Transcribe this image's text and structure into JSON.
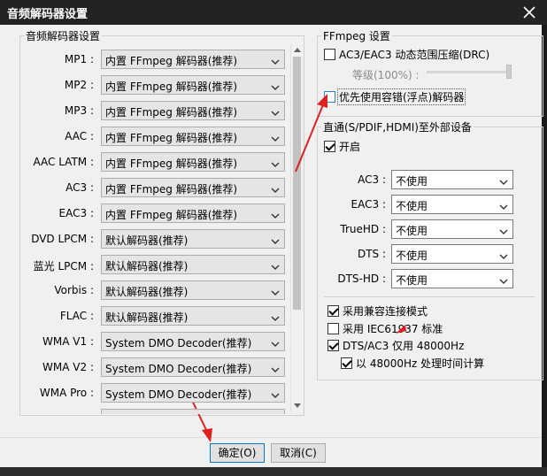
{
  "window": {
    "title": "音频解码器设置"
  },
  "left_group": {
    "title": "音频解码器设置",
    "rows": [
      {
        "label": "MP1 :",
        "value": "内置 FFmpeg 解码器(推荐)"
      },
      {
        "label": "MP2 :",
        "value": "内置 FFmpeg 解码器(推荐)"
      },
      {
        "label": "MP3 :",
        "value": "内置 FFmpeg 解码器(推荐)"
      },
      {
        "label": "AAC :",
        "value": "内置 FFmpeg 解码器(推荐)"
      },
      {
        "label": "AAC LATM :",
        "value": "内置 FFmpeg 解码器(推荐)"
      },
      {
        "label": "AC3 :",
        "value": "内置 FFmpeg 解码器(推荐)"
      },
      {
        "label": "EAC3 :",
        "value": "内置 FFmpeg 解码器(推荐)"
      },
      {
        "label": "DVD LPCM :",
        "value": "默认解码器(推荐)"
      },
      {
        "label": "蓝光 LPCM :",
        "value": "默认解码器(推荐)"
      },
      {
        "label": "Vorbis :",
        "value": "默认解码器(推荐)"
      },
      {
        "label": "FLAC :",
        "value": "默认解码器(推荐)"
      },
      {
        "label": "WMA V1 :",
        "value": "System DMO Decoder(推荐)"
      },
      {
        "label": "WMA V2 :",
        "value": "System DMO Decoder(推荐)"
      },
      {
        "label": "WMA Pro :",
        "value": "System DMO Decoder(推荐)"
      }
    ]
  },
  "ffmpeg_group": {
    "title": "FFmpeg 设置",
    "drc_label": "AC3/EAC3 动态范围压缩(DRC)",
    "level_label": "等级(100%) :",
    "float_label": "优先使用容错(浮点)解码器"
  },
  "passthrough_group": {
    "title": "直通(S/PDIF,HDMI)至外部设备",
    "enable_label": "开启",
    "rows": [
      {
        "label": "AC3 :",
        "value": "不使用"
      },
      {
        "label": "EAC3 :",
        "value": "不使用"
      },
      {
        "label": "TrueHD :",
        "value": "不使用"
      },
      {
        "label": "DTS :",
        "value": "不使用"
      },
      {
        "label": "DTS-HD :",
        "value": "不使用"
      }
    ],
    "compat_label": "采用兼容连接模式",
    "iec_label": "采用 IEC61937 标准",
    "dts48_label": "DTS/AC3 仅用 48000Hz",
    "time48_label": "以 48000Hz 处理时间计算"
  },
  "buttons": {
    "ok": "确定(O)",
    "cancel": "取消(C)"
  },
  "colors": {
    "accent": "#0078d7",
    "annotation": "#e02020"
  }
}
